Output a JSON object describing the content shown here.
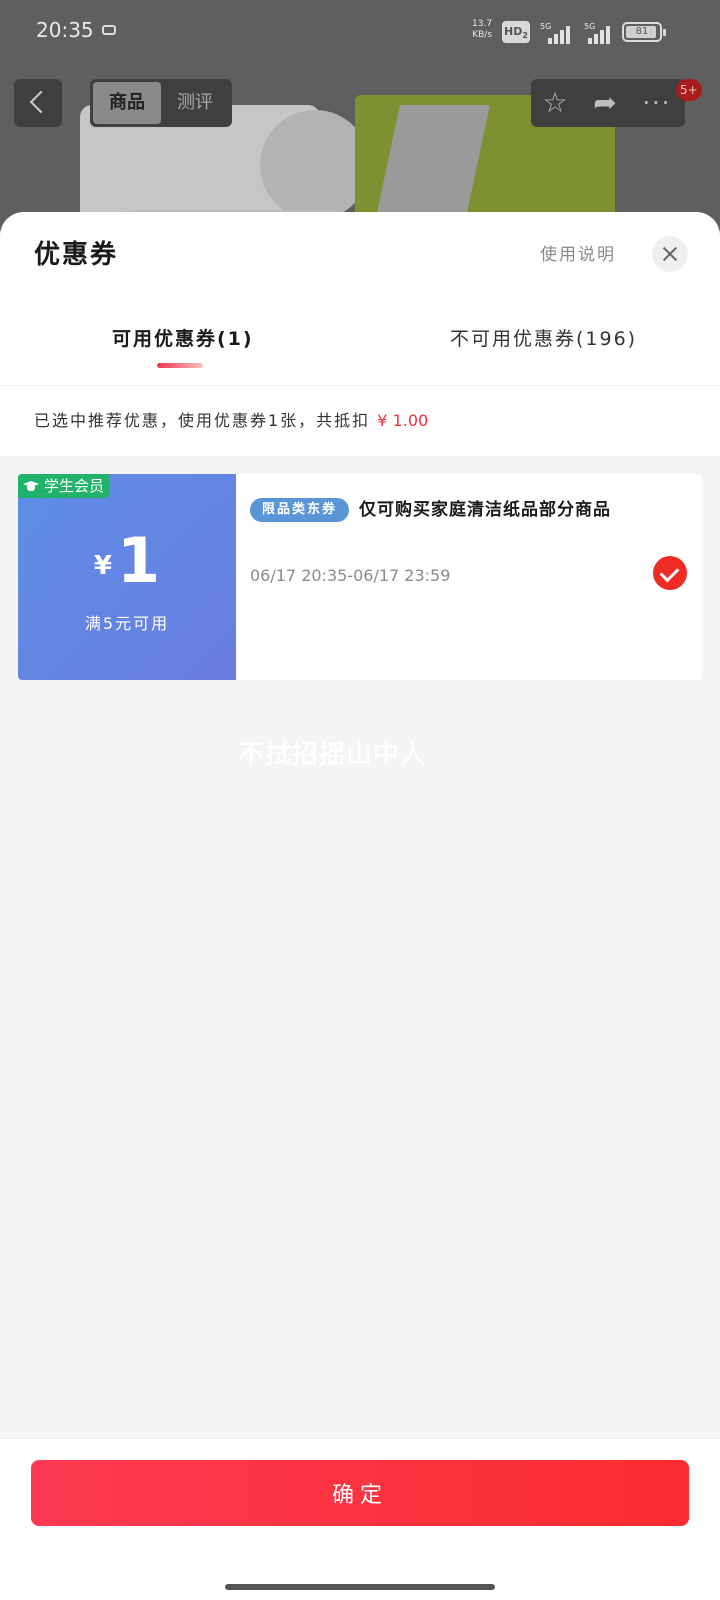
{
  "status": {
    "time": "20:35",
    "speed_value": "13.7",
    "speed_unit": "KB/s",
    "hd_label": "HD",
    "hd_sub": "2",
    "sig1_gen": "5G",
    "sig2_gen": "5G",
    "battery": "81"
  },
  "nav": {
    "tabs": [
      {
        "label": "商品",
        "active": true
      },
      {
        "label": "测评",
        "active": false
      }
    ],
    "more_badge": "5+",
    "icons": [
      "back-icon",
      "star-icon",
      "share-icon",
      "more-icon"
    ]
  },
  "sheet": {
    "title": "优惠券",
    "usage_link": "使用说明",
    "tabs": [
      {
        "label": "可用优惠券(1)",
        "active": true
      },
      {
        "label": "不可用优惠券(196)",
        "active": false
      }
    ],
    "summary": {
      "text": "已选中推荐优惠，使用优惠券1张，共抵扣",
      "amount": "¥ 1.00"
    }
  },
  "coupon": {
    "member_tag": "学生会员",
    "currency": "¥",
    "amount": "1",
    "threshold": "满5元可用",
    "scope_tag": "限品类东券",
    "scope_text": "仅可购买家庭清洁纸品部分商品",
    "validity": "06/17 20:35-06/17 23:59",
    "selected": true,
    "colors": {
      "left_bg": "#5d8ee6",
      "tag": "#21b36b",
      "check": "#ee2c24"
    }
  },
  "watermark": "不拭招摇山中人",
  "footer": {
    "confirm_label": "确定",
    "button_color": "#fd3a53"
  }
}
